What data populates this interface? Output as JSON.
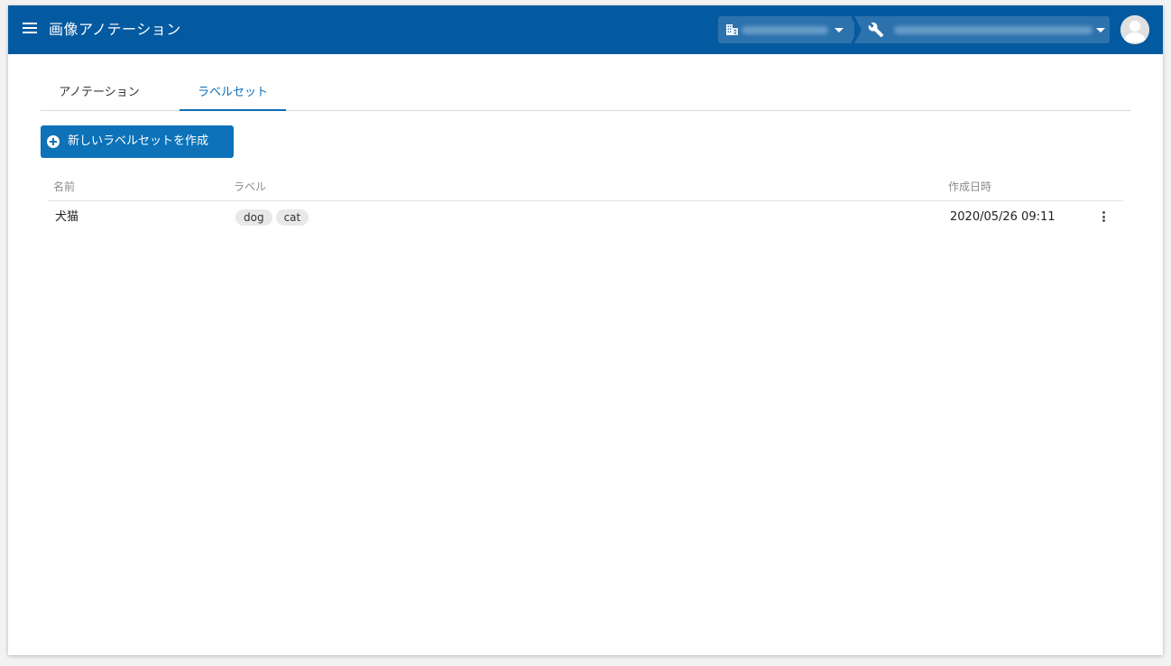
{
  "header": {
    "title": "画像アノテーション"
  },
  "tabs": [
    {
      "label": "アノテーション",
      "active": false
    },
    {
      "label": "ラベルセット",
      "active": true
    }
  ],
  "actions": {
    "create_label": "新しいラベルセットを作成"
  },
  "table": {
    "columns": [
      "名前",
      "ラベル",
      "作成日時"
    ],
    "rows": [
      {
        "name": "犬猫",
        "labels": [
          "dog",
          "cat"
        ],
        "created": "2020/05/26 09:11"
      }
    ]
  },
  "colors": {
    "appbar": "#035aa0",
    "accent": "#0d72b8",
    "tab_active": "#0d6fb6"
  },
  "icons": [
    "menu-icon",
    "building-icon",
    "dropdown-caret-icon",
    "wrench-icon",
    "account-avatar-icon",
    "add-circle-icon",
    "more-vert-icon"
  ]
}
